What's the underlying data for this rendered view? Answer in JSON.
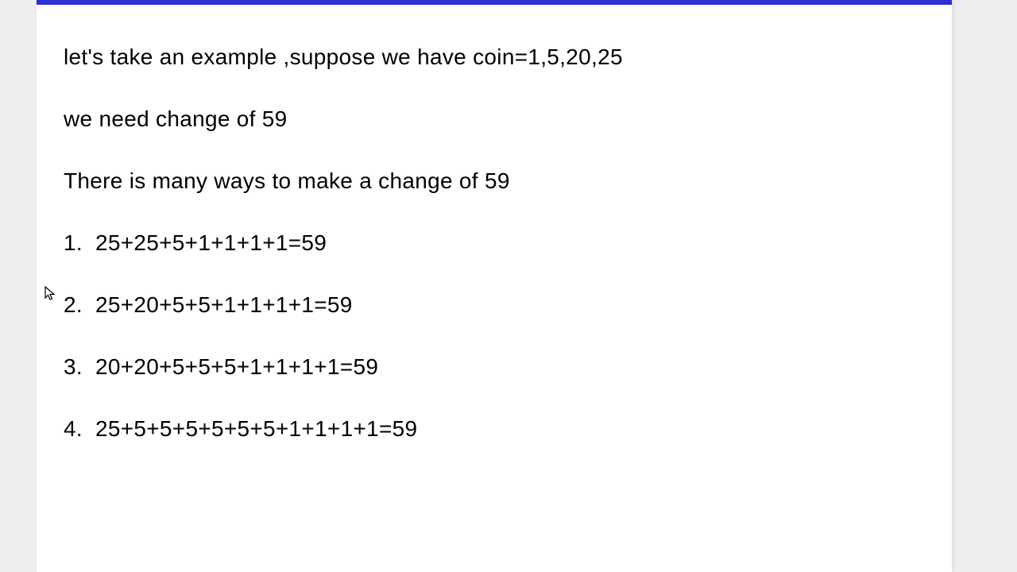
{
  "intro": {
    "line1": "let's take an example ,suppose we have coin=1,5,20,25",
    "line2": "we need change of 59",
    "line3": "There is many ways to make a change of 59"
  },
  "items": [
    {
      "num": "1.",
      "expr": "25+25+5+1+1+1+1=59"
    },
    {
      "num": "2.",
      "expr": "25+20+5+5+1+1+1+1=59"
    },
    {
      "num": "3.",
      "expr": "20+20+5+5+5+1+1+1+1=59"
    },
    {
      "num": "4.",
      "expr": "25+5+5+5+5+5+5+1+1+1+1=59"
    }
  ]
}
